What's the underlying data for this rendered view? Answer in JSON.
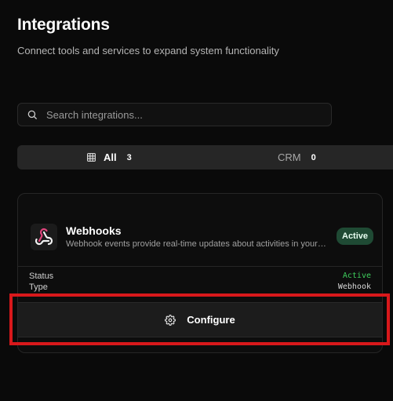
{
  "header": {
    "title": "Integrations",
    "subtitle": "Connect tools and services to expand system functionality"
  },
  "search": {
    "placeholder": "Search integrations...",
    "value": ""
  },
  "tabs": [
    {
      "label": "All",
      "count": "3",
      "icon": "grid-icon",
      "active": true
    },
    {
      "label": "CRM",
      "count": "0",
      "active": false
    }
  ],
  "card": {
    "title": "Webhooks",
    "description": "Webhook events provide real-time updates about activities in your E...",
    "badge": "Active",
    "icon": "webhook-icon",
    "fields": {
      "status_label": "Status",
      "status_value": "Active",
      "type_label": "Type",
      "type_value": "Webhook"
    },
    "configure_label": "Configure",
    "configure_icon": "gear-icon"
  },
  "colors": {
    "background": "#0a0a0a",
    "badge_bg": "#1f4a34",
    "status_active": "#3ecf5d",
    "highlight": "#d8181b"
  }
}
